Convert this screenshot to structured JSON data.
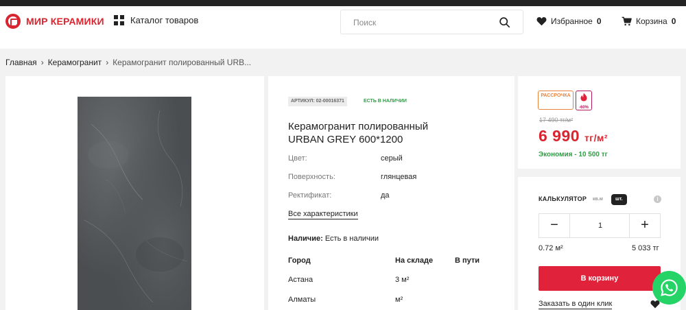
{
  "header": {
    "logo_text": "МИР КЕРАМИКИ",
    "catalog_label": "Каталог товаров",
    "search_placeholder": "Поиск",
    "favorites_label": "Избранное",
    "favorites_count": "0",
    "cart_label": "Корзина",
    "cart_count": "0"
  },
  "breadcrumb": {
    "items": [
      "Главная",
      "Керамогранит"
    ],
    "current": "Керамогранит полированный URB..."
  },
  "product": {
    "sku": "АРТИКУЛ: 02-00016371",
    "stock_status": "ЕСТЬ В НАЛИЧИИ",
    "title_line1": "Керамогранит полированный",
    "title_line2": "URBAN GREY 600*1200",
    "attributes": [
      {
        "label": "Цвет:",
        "value": "серый"
      },
      {
        "label": "Поверхность:",
        "value": "глянцевая"
      },
      {
        "label": "Ректификат:",
        "value": "да"
      }
    ],
    "all_specs_link": "Все характеристики",
    "availability_label": "Наличие:",
    "availability_value": "Есть в наличии",
    "stock_table": {
      "headers": [
        "Город",
        "На складе",
        "В пути"
      ],
      "rows": [
        [
          "Астана",
          "3 м²",
          ""
        ],
        [
          "Алматы",
          "м²",
          ""
        ]
      ]
    }
  },
  "pricing": {
    "installment_badge": "РАССРОЧКА",
    "sale_badge": "-60%",
    "old_price": "17 490 тг/м²",
    "new_price": "6 990",
    "price_unit": "тг/м²",
    "savings": "Экономия - 10 500 тг"
  },
  "calculator": {
    "title": "КАЛЬКУЛЯТОР",
    "unit_sqm": "кв.м",
    "unit_pcs": "шт.",
    "minus": "−",
    "plus": "+",
    "quantity": "1",
    "area": "0.72 м²",
    "sum": "5 033 тг",
    "add_to_cart": "В корзину",
    "one_click": "Заказать в один клик"
  },
  "colors": {
    "brand_red": "#d9252f",
    "cart_button": "#e0223a",
    "success_green": "#2f9c46",
    "whatsapp": "#25d366"
  }
}
